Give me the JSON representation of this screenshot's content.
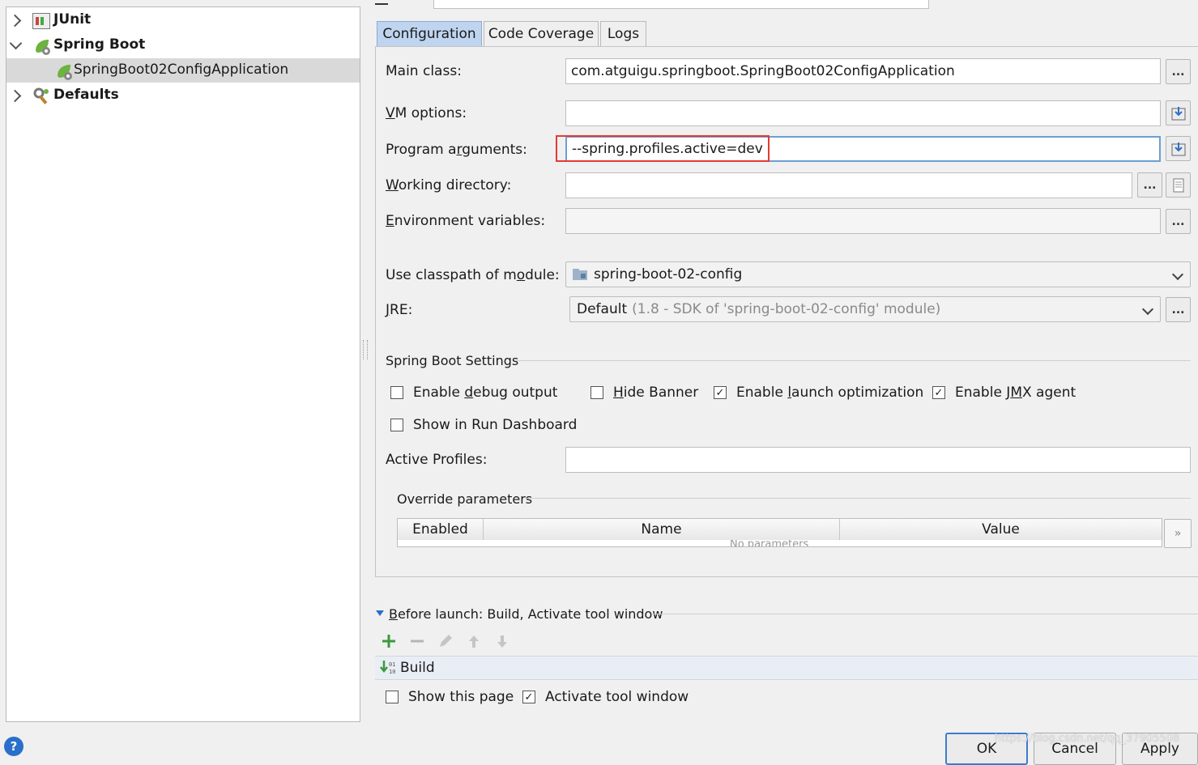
{
  "tree": {
    "items": [
      {
        "label": "JUnit",
        "icon": "junit-icon"
      },
      {
        "label": "Spring Boot",
        "icon": "spring-boot-icon"
      },
      {
        "label": "SpringBoot02ConfigApplication",
        "icon": "spring-app-icon"
      },
      {
        "label": "Defaults",
        "icon": "wrench-icon"
      }
    ]
  },
  "tabs": [
    {
      "label": "Configuration"
    },
    {
      "label": "Code Coverage"
    },
    {
      "label": "Logs"
    }
  ],
  "form": {
    "main_class_label": "Main class:",
    "main_class_value": "com.atguigu.springboot.SpringBoot02ConfigApplication",
    "vm_options_label": "VM options:",
    "vm_options_value": "",
    "program_args_label": "Program arguments:",
    "program_args_value": "--spring.profiles.active=dev",
    "working_dir_label": "Working directory:",
    "working_dir_value": "",
    "env_vars_label": "Environment variables:",
    "env_vars_value": "",
    "classpath_label": "Use classpath of module:",
    "classpath_value": "spring-boot-02-config",
    "jre_label": "JRE:",
    "jre_value": "Default",
    "jre_detail": "(1.8 - SDK of 'spring-boot-02-config' module)",
    "ellipsis": "..."
  },
  "spring_boot_settings": {
    "title": "Spring Boot Settings",
    "checkboxes": [
      {
        "label": "Enable debug output",
        "checked": false
      },
      {
        "label": "Hide Banner",
        "checked": false
      },
      {
        "label": "Enable launch optimization",
        "checked": true
      },
      {
        "label": "Enable JMX agent",
        "checked": true
      },
      {
        "label": "Show in Run Dashboard",
        "checked": false
      }
    ],
    "active_profiles_label": "Active Profiles:",
    "active_profiles_value": ""
  },
  "override_params": {
    "title": "Override parameters",
    "columns": [
      "Enabled",
      "Name",
      "Value"
    ],
    "empty_text": "No parameters",
    "more": "»"
  },
  "before_launch": {
    "title": "Before launch: Build, Activate tool window",
    "tasks": [
      "Build"
    ],
    "show_page_label": "Show this page",
    "show_page_checked": false,
    "activate_label": "Activate tool window",
    "activate_checked": true
  },
  "buttons": {
    "ok": "OK",
    "cancel": "Cancel",
    "apply": "Apply",
    "help": "?"
  },
  "watermark": "https://blog.csdn.net/qq_37905508",
  "colors": {
    "selected_tab": "#bfd4ef",
    "highlight_box": "#e53935",
    "accent_green": "#3c9a3c",
    "help_blue": "#2a6fc9"
  }
}
